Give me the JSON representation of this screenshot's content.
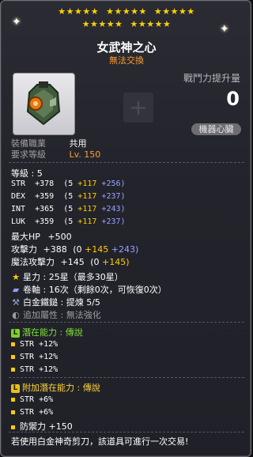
{
  "header": {
    "stars_row1": [
      "★★★★★",
      "★★★★★",
      "★★★★★"
    ],
    "stars_row2": [
      "★★★★★",
      "★★★★★"
    ],
    "title": "女武神之心",
    "subtitle": "無法交換"
  },
  "combat_power": {
    "label": "戰鬥力提升量",
    "value": "0",
    "badge": "機器心臟"
  },
  "requirements": {
    "job_label": "裝備職業",
    "job_value": "共用",
    "level_label": "要求等級",
    "level_value": "Lv. 150"
  },
  "stats": {
    "level_line": "等級 : 5",
    "str": {
      "label": "STR",
      "total": "+378",
      "base": "(5",
      "bonus": "+117",
      "star": "+256)"
    },
    "dex": {
      "label": "DEX",
      "total": "+359",
      "base": "(5",
      "bonus": "+117",
      "star": "+237)"
    },
    "int": {
      "label": "INT",
      "total": "+365",
      "base": "(5",
      "bonus": "+117",
      "star": "+243)"
    },
    "luk": {
      "label": "LUK",
      "total": "+359",
      "base": "(5",
      "bonus": "+117",
      "star": "+237)"
    },
    "hp": {
      "label": "最大HP",
      "value": "+500"
    },
    "att": {
      "label": "攻擊力",
      "total": "+388",
      "base": "(0",
      "bonus": "+145",
      "star": "+243)"
    },
    "matt": {
      "label": "魔法攻擊力",
      "total": "+145",
      "base": "(0",
      "bonus": "+145)"
    }
  },
  "enhance": {
    "starforce": "星力 : 25星（最多30星）",
    "scroll": "卷軸 : 16次（剩餘0次，可恢復0次）",
    "hammer": "白金鐵鎚 : 提煉 5/5",
    "extra": "追加屬性 : 無法強化"
  },
  "potential": {
    "header": "潛在能力 : 傳說",
    "badge": "L",
    "lines": [
      "STR +12%",
      "STR +12%",
      "STR +12%"
    ]
  },
  "additional_potential": {
    "header": "附加潛在能力 : 傳說",
    "badge": "L",
    "lines": [
      "STR +6%",
      "STR +6%",
      "防禦力 +150"
    ]
  },
  "footer": "若使用白金神奇剪刀，該道具可進行一次交易!",
  "icons": {
    "item": "heart-machine-icon",
    "star": "star-icon",
    "scroll": "scroll-icon",
    "hammer": "hammer-icon",
    "extra": "extra-option-icon"
  },
  "colors": {
    "gold": "#ffcc00",
    "blue": "#9aa2ff",
    "orange": "#ff9b33",
    "green": "#7fd22a",
    "yellow": "#e5c21a"
  }
}
